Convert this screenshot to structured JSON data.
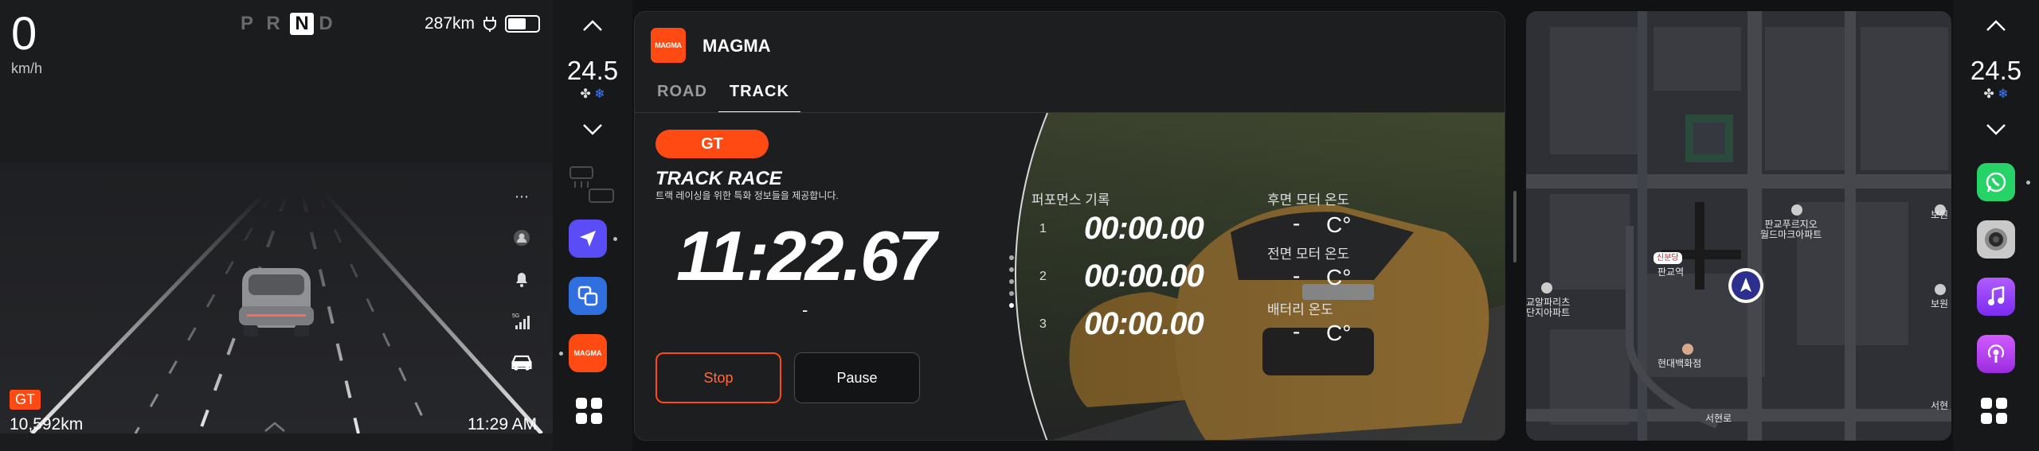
{
  "cluster": {
    "speed": "0",
    "speed_unit": "km/h",
    "gears": [
      "P",
      "R",
      "N",
      "D"
    ],
    "active_gear": "N",
    "range": "287km",
    "battery_level": 0.62,
    "badge": "GT",
    "odometer": "10,592km",
    "time": "11:29 AM",
    "icons": [
      "more-icon",
      "profile-icon",
      "bell-icon",
      "5g-signal-icon",
      "car-icon"
    ]
  },
  "climate_left": {
    "temperature": "24.5"
  },
  "climate_right": {
    "temperature": "24.5"
  },
  "app": {
    "logo_text": "MAGMA",
    "name": "MAGMA",
    "tabs": [
      {
        "label": "ROAD"
      },
      {
        "label": "TRACK"
      }
    ],
    "active_tab": "TRACK",
    "mode_pill": "GT",
    "title": "TRACK RACE",
    "subtitle": "트랙 레이싱을 위한 특화 정보들을 제공합니다.",
    "lap_time": "11:22.67",
    "lap_dash": "-",
    "stop_label": "Stop",
    "pause_label": "Pause",
    "performance_title": "퍼포먼스 기록",
    "records": [
      {
        "n": "1",
        "time": "00:00.00"
      },
      {
        "n": "2",
        "time": "00:00.00"
      },
      {
        "n": "3",
        "time": "00:00.00"
      }
    ],
    "temps": [
      {
        "label": "후면 모터 온도",
        "value": "-",
        "unit": "C°"
      },
      {
        "label": "전면 모터 온도",
        "value": "-",
        "unit": "C°"
      },
      {
        "label": "배터리 온도",
        "value": "-",
        "unit": "C°"
      }
    ]
  },
  "map": {
    "labels": {
      "station_badge": "신분당",
      "pangyo_station": "판교역",
      "alpha_dome": "판교푸르지오\n월드마크아파트",
      "hyundai": "현대백화점",
      "apartment_left": "교알파리츠\n단지아파트",
      "seohyeon": "서현로",
      "right_top": "보원",
      "right_mid": "보원",
      "right_bottom": "서현"
    }
  }
}
